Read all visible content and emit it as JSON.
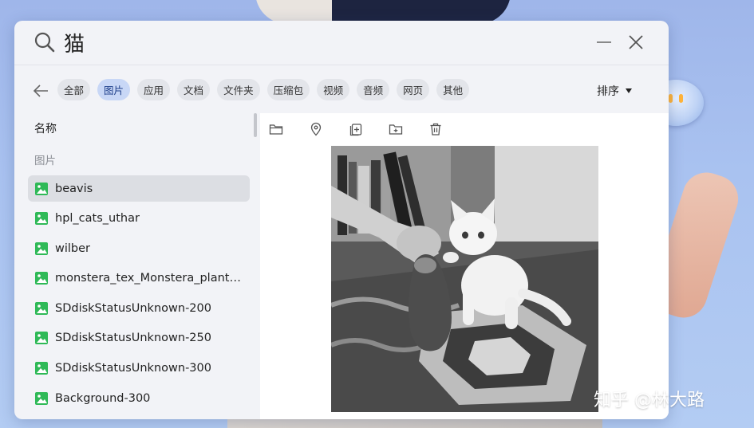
{
  "search": {
    "query": "猫"
  },
  "filters": {
    "chips": [
      {
        "label": "全部",
        "active": false
      },
      {
        "label": "图片",
        "active": true
      },
      {
        "label": "应用",
        "active": false
      },
      {
        "label": "文档",
        "active": false
      },
      {
        "label": "文件夹",
        "active": false
      },
      {
        "label": "压缩包",
        "active": false
      },
      {
        "label": "视频",
        "active": false
      },
      {
        "label": "音频",
        "active": false
      },
      {
        "label": "网页",
        "active": false
      },
      {
        "label": "其他",
        "active": false
      }
    ],
    "sort_label": "排序"
  },
  "list": {
    "column_header": "名称",
    "group_label": "图片",
    "items": [
      {
        "name": "beavis",
        "selected": true
      },
      {
        "name": "hpl_cats_uthar",
        "selected": false
      },
      {
        "name": "wilber",
        "selected": false
      },
      {
        "name": "monstera_tex_Monstera_plant3...",
        "selected": false
      },
      {
        "name": "SDdiskStatusUnknown-200",
        "selected": false
      },
      {
        "name": "SDdiskStatusUnknown-250",
        "selected": false
      },
      {
        "name": "SDdiskStatusUnknown-300",
        "selected": false
      },
      {
        "name": "Background-300",
        "selected": false
      }
    ]
  },
  "preview": {
    "toolbar": [
      "folder-icon",
      "location-pin-icon",
      "copy-icon",
      "move-to-folder-icon",
      "trash-icon"
    ]
  },
  "watermark": "知乎 @林大路",
  "colors": {
    "accent_chip_bg": "#c8d7f6",
    "accent_chip_text": "#1e3f8a",
    "image_icon_green": "#2fb957",
    "window_bg": "#f2f3f7"
  }
}
